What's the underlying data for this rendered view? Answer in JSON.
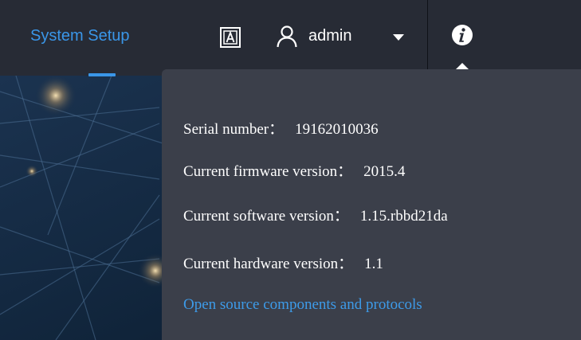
{
  "topbar": {
    "nav_item": "System Setup",
    "language_icon": "language-a-icon",
    "user_icon": "user-outline-icon",
    "user_name": "admin",
    "dropdown_icon": "caret-down-icon",
    "info_icon": "info-circle-icon",
    "accent_color": "#3a96e8"
  },
  "info_popover": {
    "separator": "：",
    "rows": [
      {
        "label": "Serial number",
        "value": "19162010036"
      },
      {
        "label": "Current firmware version",
        "value": "2015.4"
      },
      {
        "label": "Current software version",
        "value": "1.15.rbbd21da"
      },
      {
        "label": "Current hardware version",
        "value": "1.1"
      }
    ],
    "link": "Open source components and protocols",
    "link_color": "#3d9be9"
  }
}
